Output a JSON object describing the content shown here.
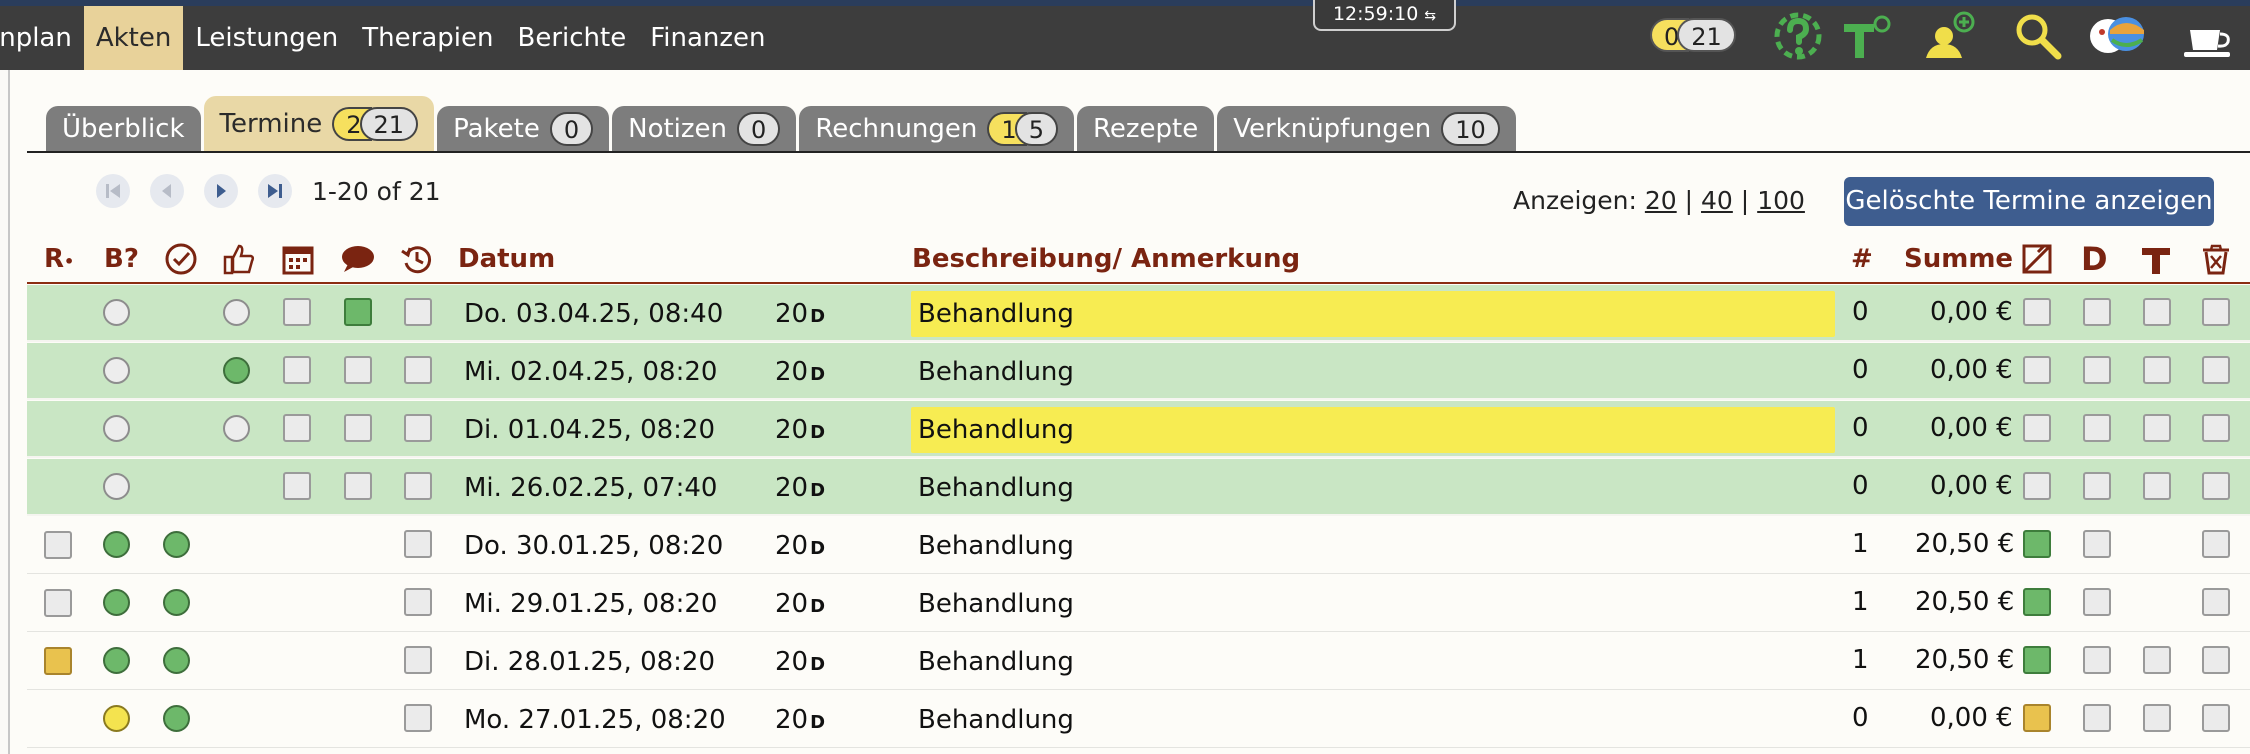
{
  "nav": {
    "items": [
      "inplan",
      "Akten",
      "Leistungen",
      "Therapien",
      "Berichte",
      "Finanzen"
    ],
    "active_index": 1
  },
  "clock": {
    "time": "12:59:10",
    "icon": "sync-icon"
  },
  "top_counter": {
    "yellow": "0",
    "grey": "21"
  },
  "top_icons": [
    "help-icon",
    "therapy-tool-icon",
    "add-person-icon",
    "search-icon",
    "masks-icon",
    "coffee-cup-icon"
  ],
  "tabs": [
    {
      "label": "Überblick"
    },
    {
      "label": "Termine",
      "yellow": "2",
      "grey": "21",
      "active": true
    },
    {
      "label": "Pakete",
      "grey": "0"
    },
    {
      "label": "Notizen",
      "grey": "0"
    },
    {
      "label": "Rechnungen",
      "yellow": "1",
      "grey": "5"
    },
    {
      "label": "Rezepte"
    },
    {
      "label": "Verknüpfungen",
      "grey": "10"
    }
  ],
  "pager": {
    "text": "1-20 of 21"
  },
  "show": {
    "label": "Anzeigen:",
    "opt1": "20",
    "opt2": "40",
    "opt3": "100",
    "sep": "|"
  },
  "deleted_button": "Gelöschte Termine anzeigen",
  "table": {
    "headers": {
      "rx": "R",
      "b": "B?",
      "datum": "Datum",
      "beschreibung": "Beschreibung/ Anmerkung",
      "num": "#",
      "summe": "Summe",
      "d": "D"
    },
    "rows": [
      {
        "date": "Do. 03.04.25, 08:40",
        "dur": "20",
        "unit": "D",
        "desc": "Behandlung",
        "num": "0",
        "sum": "0,00 €"
      },
      {
        "date": "Mi.  02.04.25, 08:20",
        "dur": "20",
        "unit": "D",
        "desc": "Behandlung",
        "num": "0",
        "sum": "0,00 €"
      },
      {
        "date": "Di.  01.04.25, 08:20",
        "dur": "20",
        "unit": "D",
        "desc": "Behandlung",
        "num": "0",
        "sum": "0,00 €"
      },
      {
        "date": "Mi.  26.02.25, 07:40",
        "dur": "20",
        "unit": "D",
        "desc": "Behandlung",
        "num": "0",
        "sum": "0,00 €"
      },
      {
        "date": "Do. 30.01.25, 08:20",
        "dur": "20",
        "unit": "D",
        "desc": "Behandlung",
        "num": "1",
        "sum": "20,50 €"
      },
      {
        "date": "Mi.  29.01.25, 08:20",
        "dur": "20",
        "unit": "D",
        "desc": "Behandlung",
        "num": "1",
        "sum": "20,50 €"
      },
      {
        "date": "Di.  28.01.25, 08:20",
        "dur": "20",
        "unit": "D",
        "desc": "Behandlung",
        "num": "1",
        "sum": "20,50 €"
      },
      {
        "date": "Mo. 27.01.25, 08:20",
        "dur": "20",
        "unit": "D",
        "desc": "Behandlung",
        "num": "0",
        "sum": "0,00 €"
      }
    ]
  },
  "colors": {
    "accent": "#3e5d8f",
    "header_text": "#7a2411",
    "row_green": "#c9e6c4",
    "highlight_yellow": "#f7ec52",
    "tab_active": "#e9d8a6",
    "tab_inactive": "#7d7d7d"
  }
}
